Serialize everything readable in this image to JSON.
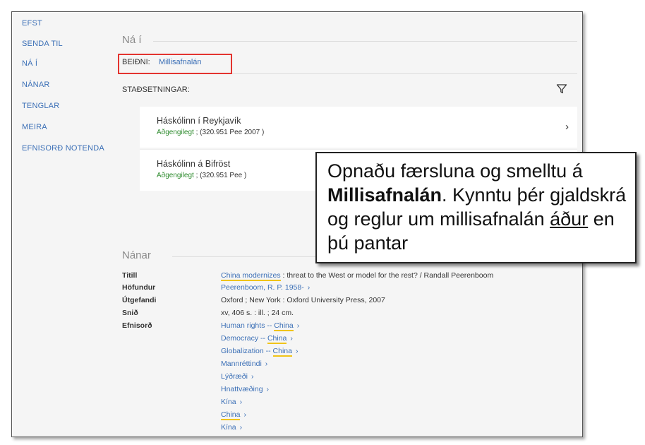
{
  "sidebar": {
    "items": [
      {
        "label": "EFST"
      },
      {
        "label": "SENDA TIL"
      },
      {
        "label": "NÁ Í"
      },
      {
        "label": "NÁNAR"
      },
      {
        "label": "TENGLAR"
      },
      {
        "label": "MEIRA"
      },
      {
        "label": "EFNISORÐ NOTENDA"
      }
    ]
  },
  "get_it": {
    "heading": "Ná í",
    "request_label": "BEIÐNI:",
    "request_link": "Millisafnalán",
    "locations_label": "STAÐSETNINGAR:",
    "filter_icon": "filter-icon",
    "locations": [
      {
        "name": "Háskólinn í Reykjavík",
        "status": "Aðgengilegt",
        "callnumber": " ; (320.951 Pee 2007 )"
      },
      {
        "name": "Háskólinn á Bifröst",
        "status": "Aðgengilegt",
        "callnumber": " ; (320.951 Pee )"
      }
    ]
  },
  "details": {
    "heading": "Nánar",
    "title_key": "Titill",
    "title_link": "China modernizes",
    "title_rest": " : threat to the West or model for the rest? / Randall Peerenboom",
    "author_key": "Höfundur",
    "author_value": "Peerenboom, R. P. 1958-",
    "publisher_key": "Útgefandi",
    "publisher_value": "Oxford ; New York : Oxford University Press, 2007",
    "format_key": "Snið",
    "format_value": "xv, 406 s. : ill. ; 24 cm.",
    "subjects_key": "Efnisorð",
    "subjects": [
      {
        "prefix": "Human rights -- ",
        "hl": "China"
      },
      {
        "prefix": "Democracy -- ",
        "hl": "China"
      },
      {
        "prefix": "Globalization -- ",
        "hl": "China"
      },
      {
        "prefix": "Mannréttindi",
        "hl": ""
      },
      {
        "prefix": "Lýðræði",
        "hl": ""
      },
      {
        "prefix": "Hnattvæðing",
        "hl": ""
      },
      {
        "prefix": "Kína",
        "hl": ""
      },
      {
        "prefix": "",
        "hl": "China"
      },
      {
        "prefix": "Kína",
        "hl": ""
      }
    ]
  },
  "callout": {
    "line1_pre": "Opnaðu færsluna og smelltu á ",
    "line1_bold": "Millisafnalán",
    "line1_post": ". Kynntu þér gjaldskrá og reglur um millisafnalán ",
    "underlined": "áður",
    "line_end": " en þú pantar"
  },
  "colors": {
    "link": "#3b6fb6",
    "available": "#2e8b2e",
    "highlight_box": "#e3342f",
    "subject_underline": "#f0c419"
  }
}
